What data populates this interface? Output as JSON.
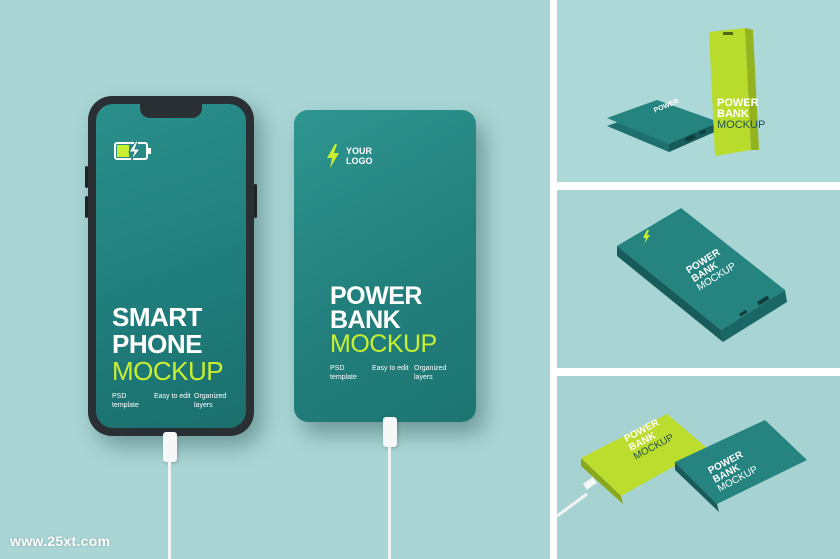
{
  "phone": {
    "title_lines": [
      "SMART",
      "PHONE"
    ],
    "accent_line": "MOCKUP",
    "features": [
      "PSD template",
      "Easy to edit",
      "Organized layers"
    ]
  },
  "bank": {
    "logo_lines": [
      "YOUR",
      "LOGO"
    ],
    "title_lines": [
      "POWER",
      "BANK"
    ],
    "accent_line": "MOCKUP",
    "features": [
      "PSD template",
      "Easy to edit",
      "Organized layers"
    ]
  },
  "thumb1": {
    "title_lines": [
      "POWER",
      "BANK"
    ],
    "accent_line": "MOCKUP"
  },
  "thumb2": {
    "title_lines": [
      "POWER",
      "BANK"
    ],
    "accent_line": "MOCKUP"
  },
  "thumb3": {
    "lines_a": [
      "POWER",
      "BANK",
      "MOCKUP"
    ],
    "lines_b": [
      "POWER",
      "BANK",
      "MOCKUP"
    ]
  },
  "watermark": "www.25xt.com",
  "colors": {
    "teal": "#22807c",
    "lime": "#c8f031",
    "background": "#a9d6d5"
  }
}
